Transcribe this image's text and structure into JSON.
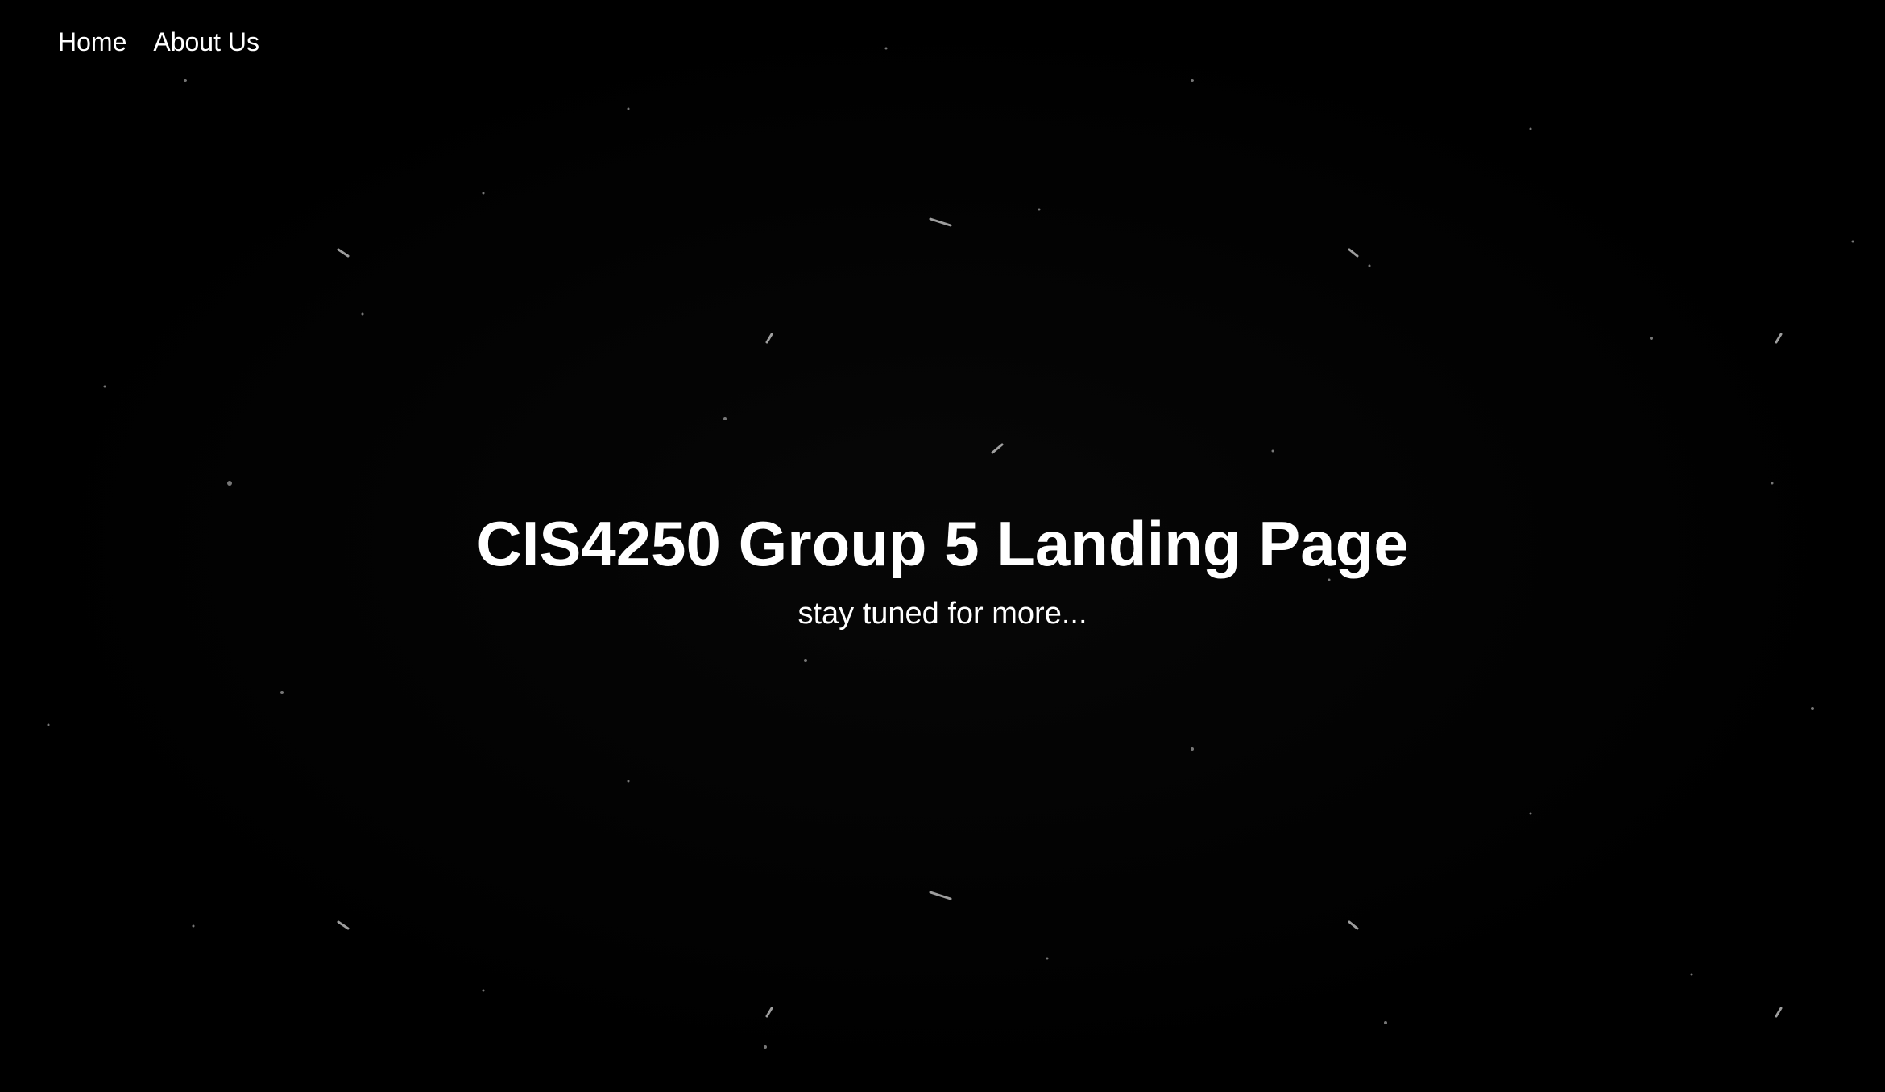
{
  "nav": {
    "items": [
      {
        "label": "Home"
      },
      {
        "label": "About Us"
      }
    ]
  },
  "hero": {
    "title": "CIS4250 Group 5 Landing Page",
    "subtitle": "stay tuned for more..."
  },
  "colors": {
    "background": "#000000",
    "text": "#ffffff"
  }
}
